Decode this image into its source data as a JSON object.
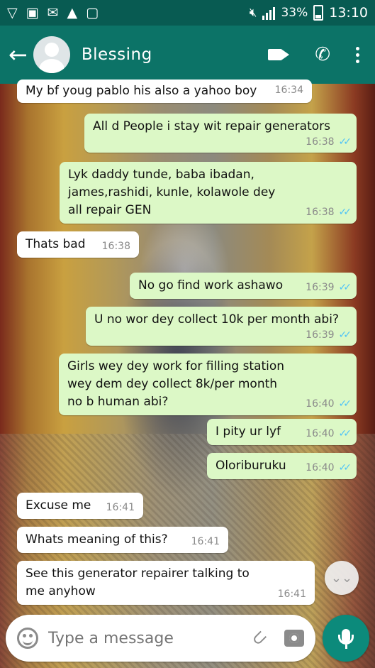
{
  "status_bar": {
    "time": "13:10",
    "battery": "33%",
    "icons": [
      "notification-v-icon",
      "gallery-icon",
      "bbm-icon",
      "warning-icon",
      "clipboard-icon",
      "mute-icon",
      "signal-icon",
      "battery-icon"
    ]
  },
  "header": {
    "contact_name": "Blessing",
    "icons": [
      "back-arrow-icon",
      "avatar-placeholder",
      "video-call-icon",
      "phone-icon",
      "more-vert-icon"
    ]
  },
  "messages": [
    {
      "dir": "in",
      "text": "My bf youg pablo his also a yahoo boy",
      "time": "16:34"
    },
    {
      "dir": "out",
      "text": "All d People i stay wit repair generators",
      "time": "16:38",
      "ticks": "✓✓"
    },
    {
      "dir": "out",
      "text": "Lyk daddy tunde, baba ibadan, james,rashidi, kunle, kolawole dey all repair GEN",
      "time": "16:38",
      "ticks": "✓✓"
    },
    {
      "dir": "in",
      "text": "Thats bad",
      "time": "16:38"
    },
    {
      "dir": "out",
      "text": "No go find work ashawo",
      "time": "16:39",
      "ticks": "✓✓"
    },
    {
      "dir": "out",
      "text": "U no wor dey collect 10k per month abi?",
      "time": "16:39",
      "ticks": "✓✓"
    },
    {
      "dir": "out",
      "text": "Girls wey dey work for filling station wey dem dey collect 8k/per month no b human abi?",
      "time": "16:40",
      "ticks": "✓✓"
    },
    {
      "dir": "out",
      "text": "I pity ur lyf",
      "time": "16:40",
      "ticks": "✓✓"
    },
    {
      "dir": "out",
      "text": "Oloriburuku",
      "time": "16:40",
      "ticks": "✓✓"
    },
    {
      "dir": "in",
      "text": "Excuse me",
      "time": "16:41"
    },
    {
      "dir": "in",
      "text": "Whats meaning of this?",
      "time": "16:41"
    },
    {
      "dir": "in",
      "text": "See this generator repairer talking to me anyhow",
      "time": "16:41"
    }
  ],
  "composer": {
    "placeholder": "Type a message",
    "icons": [
      "emoji-icon",
      "attach-icon",
      "camera-icon",
      "mic-icon"
    ]
  },
  "scroll_button": {
    "icon": "chevron-down-icon"
  }
}
